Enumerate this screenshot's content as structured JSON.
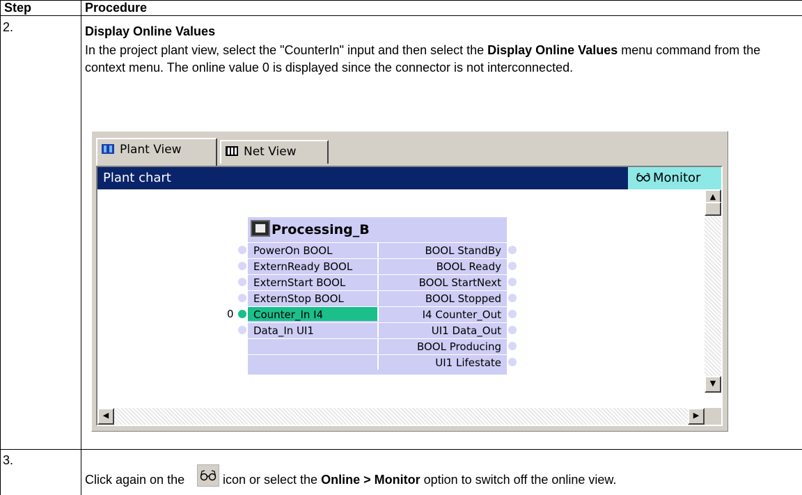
{
  "table": {
    "header_step": "Step",
    "header_procedure": "Procedure"
  },
  "step2": {
    "number": "2.",
    "title": "Display Online Values",
    "text_part1": "In the project plant view, select the \"CounterIn\" input and then select the ",
    "text_bold": "Display Online Values",
    "text_part2": " menu command from the context menu. The online value 0 is displayed since the connector is not interconnected."
  },
  "screenshot": {
    "tabs": [
      {
        "label": "Plant View",
        "active": true
      },
      {
        "label": "Net View",
        "active": false
      }
    ],
    "title": "Plant chart",
    "monitor_label": "Monitor",
    "block": {
      "name": "Processing_B",
      "inputs": [
        "PowerOn BOOL",
        "ExternReady BOOL",
        "ExternStart BOOL",
        "ExternStop BOOL",
        "Counter_In I4",
        "Data_In UI1",
        "",
        ""
      ],
      "outputs": [
        "BOOL StandBy",
        "BOOL Ready",
        "BOOL StartNext",
        "BOOL Stopped",
        "I4 Counter_Out",
        "UI1 Data_Out",
        "BOOL Producing",
        "UI1 Lifestate"
      ],
      "online_value": "0",
      "highlighted_input_index": 4
    },
    "colors": {
      "titlebar": "#0a246a",
      "monitor_badge": "#8ee8e6",
      "block_bg": "#cdcdf5",
      "highlight": "#1abf8a"
    }
  },
  "step3": {
    "number": "3.",
    "text_part1": "Click again on the ",
    "text_part2": " icon or select the ",
    "text_bold": "Online > Monitor",
    "text_part3": " option to switch off the online view.",
    "icon_glyph": "ɷ"
  }
}
